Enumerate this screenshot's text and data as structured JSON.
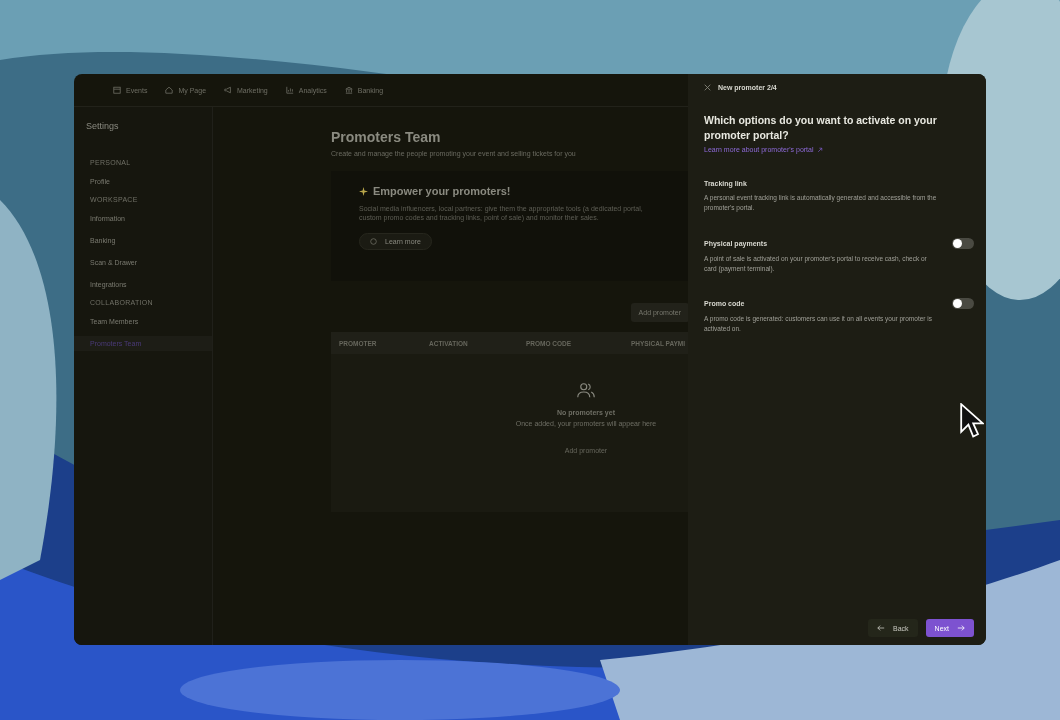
{
  "nav": [
    {
      "kind": "calendar",
      "label": "Events"
    },
    {
      "kind": "home",
      "label": "My Page"
    },
    {
      "kind": "megaphone",
      "label": "Marketing"
    },
    {
      "kind": "chart",
      "label": "Analytics"
    },
    {
      "kind": "bank",
      "label": "Banking"
    }
  ],
  "sidebar": {
    "title": "Settings",
    "sections": [
      {
        "heading": "PERSONAL",
        "items": [
          {
            "label": "Profile",
            "selected": false
          }
        ]
      },
      {
        "heading": "WORKSPACE",
        "items": [
          {
            "label": "Information",
            "selected": false
          },
          {
            "label": "Banking",
            "selected": false
          },
          {
            "label": "Scan & Drawer",
            "selected": false
          },
          {
            "label": "Integrations",
            "selected": false
          }
        ]
      },
      {
        "heading": "COLLABORATION",
        "items": [
          {
            "label": "Team Members",
            "selected": false
          },
          {
            "label": "Promoters Team",
            "selected": true
          }
        ]
      }
    ]
  },
  "page": {
    "title": "Promoters Team",
    "subtitle": "Create and manage the people promoting your event and selling tickets for you",
    "banner": {
      "title": "Empower your promoters!",
      "text": "Social media influencers, local partners: give them the appropriate tools (a dedicated portal, custom promo codes and tracking links, point of sale) and monitor their sales.",
      "button": "Learn more"
    },
    "add_button": "Add promoter",
    "table": {
      "columns": [
        "PROMOTER",
        "ACTIVATION",
        "PROMO CODE",
        "PHYSICAL PAYMI"
      ],
      "empty_title": "No promoters yet",
      "empty_text": "Once added, your promoters will appear here",
      "empty_action": "Add promoter"
    }
  },
  "panel": {
    "title": "New promoter 2/4",
    "question": "Which options do you want to activate on your promoter portal?",
    "link": "Learn more about promoter's portal",
    "options": [
      {
        "kind": "info",
        "title": "Tracking link",
        "text": "A personal event tracking link is automatically generated and accessible from the promoter's portal."
      },
      {
        "kind": "toggle",
        "title": "Physical payments",
        "text": "A point of sale is activated on your promoter's portal to receive cash, check or card (payment terminal).",
        "on": false
      },
      {
        "kind": "toggle",
        "title": "Promo code",
        "text": "A promo code is generated: customers can use it on all events your promoter is activated on.",
        "on": false
      }
    ],
    "back": "Back",
    "next": "Next"
  }
}
